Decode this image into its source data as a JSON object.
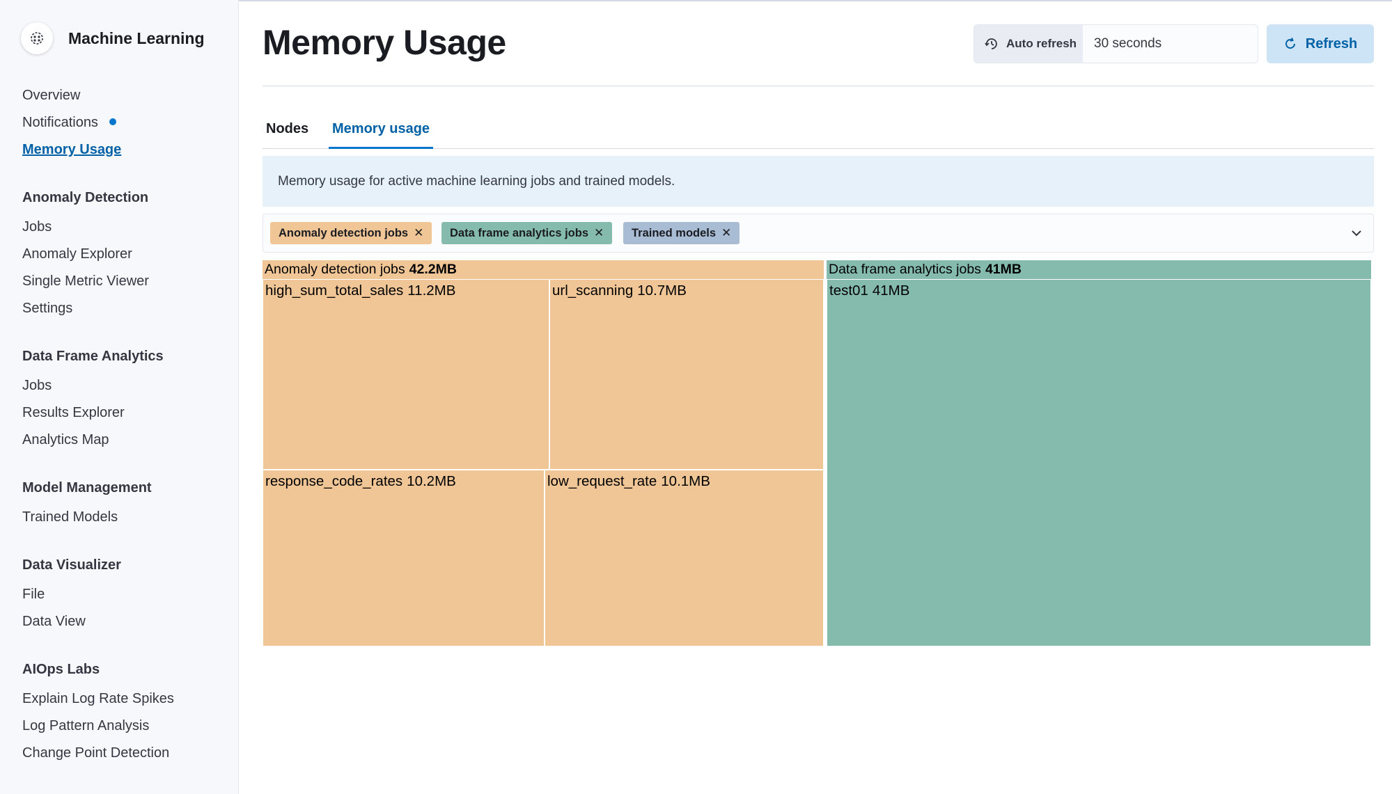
{
  "app": {
    "title": "Machine Learning",
    "logo_icon": "machine-learning-logo-icon"
  },
  "sidebar": {
    "top_items": [
      {
        "label": "Overview",
        "active": false
      },
      {
        "label": "Notifications",
        "active": false,
        "has_dot": true
      },
      {
        "label": "Memory Usage",
        "active": true
      }
    ],
    "sections": [
      {
        "heading": "Anomaly Detection",
        "items": [
          "Jobs",
          "Anomaly Explorer",
          "Single Metric Viewer",
          "Settings"
        ]
      },
      {
        "heading": "Data Frame Analytics",
        "items": [
          "Jobs",
          "Results Explorer",
          "Analytics Map"
        ]
      },
      {
        "heading": "Model Management",
        "items": [
          "Trained Models"
        ]
      },
      {
        "heading": "Data Visualizer",
        "items": [
          "File",
          "Data View"
        ]
      },
      {
        "heading": "AIOps Labs",
        "items": [
          "Explain Log Rate Spikes",
          "Log Pattern Analysis",
          "Change Point Detection"
        ]
      }
    ]
  },
  "header": {
    "title": "Memory Usage",
    "auto_refresh_label": "Auto refresh",
    "auto_refresh_value": "30 seconds",
    "refresh_label": "Refresh"
  },
  "tabs": [
    {
      "label": "Nodes",
      "selected": false
    },
    {
      "label": "Memory usage",
      "selected": true
    }
  ],
  "callout": {
    "text": "Memory usage for active machine learning jobs and trained models."
  },
  "filters": [
    {
      "label": "Anomaly detection jobs",
      "color": "#f1c696"
    },
    {
      "label": "Data frame analytics jobs",
      "color": "#85bbad"
    },
    {
      "label": "Trained models",
      "color": "#a8bcd3"
    }
  ],
  "colors": {
    "accent": "#0077cc",
    "anomaly_detection": "#f1c696",
    "data_frame_analytics": "#85bbad",
    "trained_models": "#a8bcd3"
  },
  "chart_data": {
    "type": "treemap",
    "groups": [
      {
        "name": "Anomaly detection jobs",
        "total_label": "42.2MB",
        "value_mb": 42.2,
        "color": "#f1c696",
        "items": [
          {
            "name": "high_sum_total_sales",
            "label": "11.2MB",
            "value_mb": 11.2
          },
          {
            "name": "url_scanning",
            "label": "10.7MB",
            "value_mb": 10.7
          },
          {
            "name": "response_code_rates",
            "label": "10.2MB",
            "value_mb": 10.2
          },
          {
            "name": "low_request_rate",
            "label": "10.1MB",
            "value_mb": 10.1
          }
        ]
      },
      {
        "name": "Data frame analytics jobs",
        "total_label": "41MB",
        "value_mb": 41,
        "color": "#85bbad",
        "items": [
          {
            "name": "test01",
            "label": "41MB",
            "value_mb": 41
          }
        ]
      }
    ]
  }
}
